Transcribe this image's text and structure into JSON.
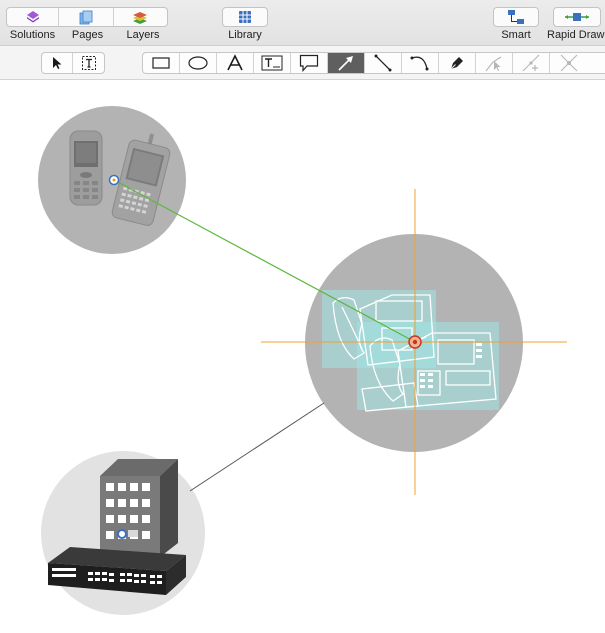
{
  "toolbar": {
    "solutions": "Solutions",
    "pages": "Pages",
    "layers": "Layers",
    "library": "Library",
    "smart": "Smart",
    "rapid_draw": "Rapid Draw"
  },
  "tools": {
    "active_tool": "line-arrow",
    "items": [
      "selection",
      "text-selection",
      "rectangle",
      "ellipse",
      "text",
      "text-box",
      "callout",
      "line-arrow",
      "straight-line",
      "curved-line",
      "pen",
      "point-edit",
      "add-point",
      "delete-point"
    ]
  },
  "colors": {
    "connector_selected": "#5bb83a",
    "connector": "#555555",
    "crosshair": "#f0a030",
    "node_fill": "#b3b3b3",
    "selection_tint": "#9fe3e3"
  },
  "canvas": {
    "nodes": [
      "mobile-phones-node",
      "ip-phones-node",
      "building-switch-node"
    ],
    "connections": [
      {
        "from": "mobile-phones-node",
        "to": "ip-phones-node",
        "selected": true
      },
      {
        "from": "building-switch-node",
        "to": "ip-phones-node",
        "selected": false
      }
    ]
  }
}
